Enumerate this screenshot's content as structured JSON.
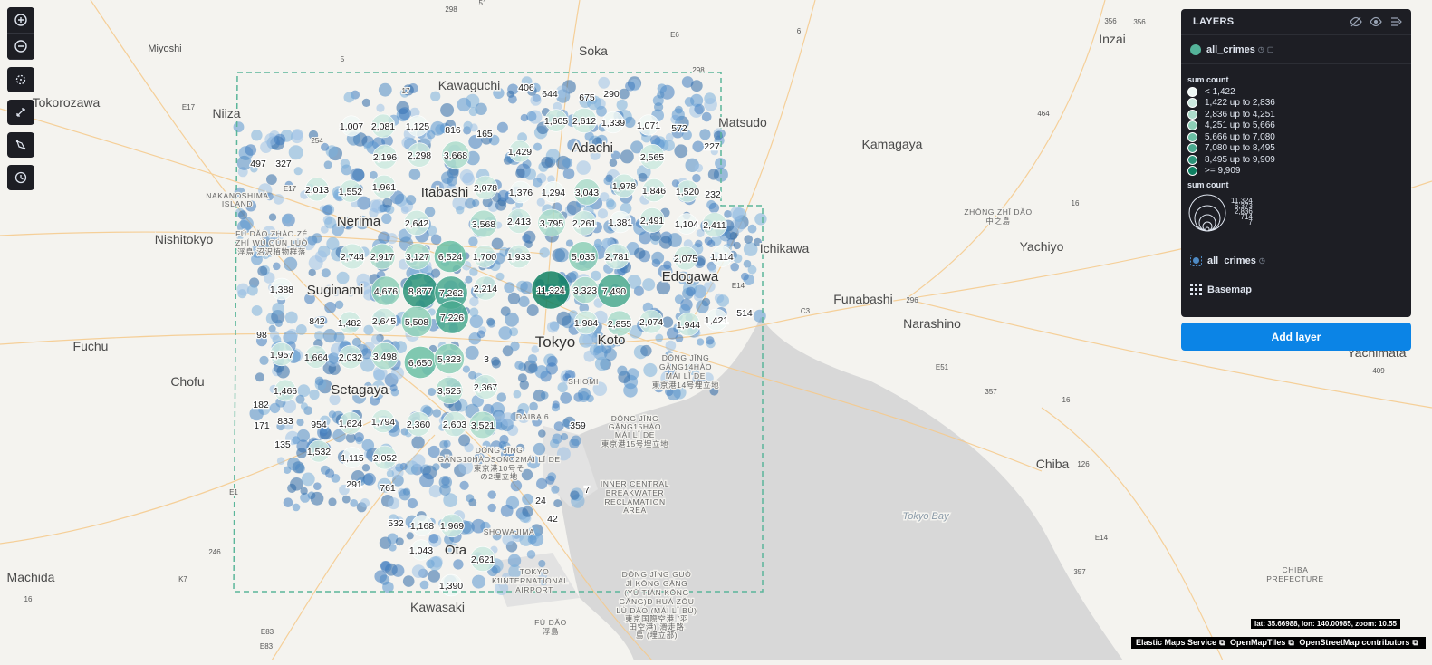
{
  "map": {
    "places": [
      {
        "name": "Soka",
        "kind": "city"
      },
      {
        "name": "Kawaguchi",
        "kind": "city"
      },
      {
        "name": "Miyoshi",
        "kind": "town"
      },
      {
        "name": "Tokorozawa",
        "kind": "city"
      },
      {
        "name": "Niiza",
        "kind": "city"
      },
      {
        "name": "Matsudo",
        "kind": "city"
      },
      {
        "name": "Inzai",
        "kind": "city"
      },
      {
        "name": "Kamagaya",
        "kind": "city"
      },
      {
        "name": "Adachi",
        "kind": "ward"
      },
      {
        "name": "Itabashi",
        "kind": "ward"
      },
      {
        "name": "Nerima",
        "kind": "ward"
      },
      {
        "name": "Nishitokyo",
        "kind": "city"
      },
      {
        "name": "Ichikawa",
        "kind": "city"
      },
      {
        "name": "Yachiyo",
        "kind": "city"
      },
      {
        "name": "Edogawa",
        "kind": "ward"
      },
      {
        "name": "Suginami",
        "kind": "ward"
      },
      {
        "name": "Funabashi",
        "kind": "city"
      },
      {
        "name": "Narashino",
        "kind": "city"
      },
      {
        "name": "Fuchu",
        "kind": "city"
      },
      {
        "name": "Tokyo",
        "kind": "big"
      },
      {
        "name": "Koto",
        "kind": "ward"
      },
      {
        "name": "Yachimata",
        "kind": "city"
      },
      {
        "name": "Chofu",
        "kind": "city"
      },
      {
        "name": "Setagaya",
        "kind": "ward"
      },
      {
        "name": "Chiba",
        "kind": "city"
      },
      {
        "name": "Machida",
        "kind": "city"
      },
      {
        "name": "Ota",
        "kind": "ward"
      },
      {
        "name": "Kawasaki",
        "kind": "city"
      },
      {
        "name": "Tokyo Bay",
        "kind": "water"
      }
    ],
    "small_labels": [
      {
        "text": "NAKANOSHIMA"
      },
      {
        "text": "ISLAND"
      },
      {
        "text": "FÚ DĂO ZHÀO ZÉ"
      },
      {
        "text": "ZHÍ WÙ QÚN LUÒ"
      },
      {
        "text": "浮島 沼沢植物群落"
      },
      {
        "text": "ZHŌNG ZHĪ DĂO"
      },
      {
        "text": "中之島"
      },
      {
        "text": "DŌNG JĪNG"
      },
      {
        "text": "GĂNG14HÀO"
      },
      {
        "text": "MÁI LĬ DE"
      },
      {
        "text": "東京港14号埋立地"
      },
      {
        "text": "SHIOMI"
      },
      {
        "text": "DAIBA 6"
      },
      {
        "text": "DŌNG JĪNG"
      },
      {
        "text": "GĂNG15HÀO"
      },
      {
        "text": "MÁI LĬ DE"
      },
      {
        "text": "東京港15号埋立地"
      },
      {
        "text": "DŌNG JĪNG"
      },
      {
        "text": "GĂNG10HÀOSONO2MÁI LĬ DE"
      },
      {
        "text": "東京港10号そ"
      },
      {
        "text": "の2埋立地"
      },
      {
        "text": "INNER CENTRAL"
      },
      {
        "text": "BREAKWATER"
      },
      {
        "text": "RECLAMATION"
      },
      {
        "text": "AREA"
      },
      {
        "text": "SHOWAJIMA"
      },
      {
        "text": "TOKYO"
      },
      {
        "text": "INTERNATIONAL"
      },
      {
        "text": "AIRPORT"
      },
      {
        "text": "DŌNG JĪNG GUÓ"
      },
      {
        "text": "JÌ KŌNG GĂNG"
      },
      {
        "text": "(YŬ TIÁN KŌNG"
      },
      {
        "text": "GĂNG)D HUÁ ZŎU"
      },
      {
        "text": "LÙ DĂO (MÁI LĬ BÙ)"
      },
      {
        "text": "東京国際空港 (羽"
      },
      {
        "text": "田空港) 滑走路"
      },
      {
        "text": "島 (埋立部)"
      },
      {
        "text": "FÚ DĂO"
      },
      {
        "text": "浮島"
      },
      {
        "text": "CHIBA"
      },
      {
        "text": "PREFECTURE"
      }
    ],
    "road_shields": [
      "298",
      "51",
      "5",
      "17",
      "E6",
      "298",
      "6",
      "356",
      "356",
      "E17",
      "254",
      "E17",
      "464",
      "16",
      "296",
      "C3",
      "E51",
      "357",
      "16",
      "409",
      "E83",
      "E1",
      "246",
      "K7",
      "16",
      "E83",
      "K1",
      "E14",
      "357",
      "126",
      "E14"
    ],
    "cluster_labels": [
      {
        "label": "1,007"
      },
      {
        "label": "2,081"
      },
      {
        "label": "1,125"
      },
      {
        "label": "816"
      },
      {
        "label": "165"
      },
      {
        "label": "406"
      },
      {
        "label": "644"
      },
      {
        "label": "675"
      },
      {
        "label": "290"
      },
      {
        "label": "1,605"
      },
      {
        "label": "2,612"
      },
      {
        "label": "1,339"
      },
      {
        "label": "1,071"
      },
      {
        "label": "572"
      },
      {
        "label": "2,196"
      },
      {
        "label": "2,298"
      },
      {
        "label": "3,668"
      },
      {
        "label": "1,429"
      },
      {
        "label": "2,565"
      },
      {
        "label": "227"
      },
      {
        "label": "497"
      },
      {
        "label": "327"
      },
      {
        "label": "2,013"
      },
      {
        "label": "1,552"
      },
      {
        "label": "1,961"
      },
      {
        "label": "2,078"
      },
      {
        "label": "1,376"
      },
      {
        "label": "1,294"
      },
      {
        "label": "3,043"
      },
      {
        "label": "1,978"
      },
      {
        "label": "1,846"
      },
      {
        "label": "1,520"
      },
      {
        "label": "232"
      },
      {
        "label": "2,642"
      },
      {
        "label": "3,568"
      },
      {
        "label": "2,413"
      },
      {
        "label": "3,795"
      },
      {
        "label": "2,261"
      },
      {
        "label": "1,381"
      },
      {
        "label": "2,491"
      },
      {
        "label": "1,104"
      },
      {
        "label": "2,411"
      },
      {
        "label": "2,744"
      },
      {
        "label": "2,917"
      },
      {
        "label": "3,127"
      },
      {
        "label": "6,524"
      },
      {
        "label": "1,700"
      },
      {
        "label": "1,933"
      },
      {
        "label": "5,035"
      },
      {
        "label": "2,781"
      },
      {
        "label": "2,075"
      },
      {
        "label": "1,114"
      },
      {
        "label": "1,388"
      },
      {
        "label": "4,676"
      },
      {
        "label": "8,877"
      },
      {
        "label": "7,262"
      },
      {
        "label": "2,214"
      },
      {
        "label": "11,324"
      },
      {
        "label": "3,323"
      },
      {
        "label": "7,490"
      },
      {
        "label": "842"
      },
      {
        "label": "1,482"
      },
      {
        "label": "2,645"
      },
      {
        "label": "5,508"
      },
      {
        "label": "7,226"
      },
      {
        "label": "1,984"
      },
      {
        "label": "2,855"
      },
      {
        "label": "2,074"
      },
      {
        "label": "1,944"
      },
      {
        "label": "1,421"
      },
      {
        "label": "514"
      },
      {
        "label": "98"
      },
      {
        "label": "1,957"
      },
      {
        "label": "1,664"
      },
      {
        "label": "2,032"
      },
      {
        "label": "3,498"
      },
      {
        "label": "6,650"
      },
      {
        "label": "5,323"
      },
      {
        "label": "3"
      },
      {
        "label": "1,466"
      },
      {
        "label": "3,525"
      },
      {
        "label": "2,367"
      },
      {
        "label": "182"
      },
      {
        "label": "171"
      },
      {
        "label": "833"
      },
      {
        "label": "954"
      },
      {
        "label": "1,624"
      },
      {
        "label": "1,794"
      },
      {
        "label": "2,360"
      },
      {
        "label": "2,603"
      },
      {
        "label": "3,521"
      },
      {
        "label": "359"
      },
      {
        "label": "135"
      },
      {
        "label": "1,532"
      },
      {
        "label": "1,115"
      },
      {
        "label": "2,052"
      },
      {
        "label": "291"
      },
      {
        "label": "761"
      },
      {
        "label": "7"
      },
      {
        "label": "24"
      },
      {
        "label": "42"
      },
      {
        "label": "532"
      },
      {
        "label": "1,168"
      },
      {
        "label": "1,969"
      },
      {
        "label": "1,043"
      },
      {
        "label": "2,621"
      },
      {
        "label": "1,390"
      }
    ]
  },
  "controls": {
    "zoom_in": "zoom-in",
    "zoom_out": "zoom-out"
  },
  "layers_panel": {
    "title": "LAYERS",
    "layers": [
      {
        "name": "all_crimes",
        "type": "clusters"
      },
      {
        "name": "all_crimes",
        "type": "documents"
      },
      {
        "name": "Basemap",
        "type": "basemap"
      }
    ],
    "legend": {
      "color_title": "sum count",
      "color_items": [
        {
          "label": "< 1,422",
          "color": "#eef7f4"
        },
        {
          "label": "1,422 up to 2,836",
          "color": "#cbe9df"
        },
        {
          "label": "2,836 up to 4,251",
          "color": "#acdccb"
        },
        {
          "label": "4,251 up to 5,666",
          "color": "#8dcfb7"
        },
        {
          "label": "5,666 up to 7,080",
          "color": "#6bbfa4"
        },
        {
          "label": "7,080 up to 8,495",
          "color": "#4aa98f"
        },
        {
          "label": "8,495 up to 9,909",
          "color": "#2d9479"
        },
        {
          "label": ">= 9,909",
          "color": "#108062"
        }
      ],
      "size_title": "sum count",
      "size_values": [
        "11,324",
        "6,373",
        "2,836",
        "714",
        "7"
      ]
    },
    "add_layer_label": "Add layer"
  },
  "status": {
    "coordinates": "lat: 35.66988, lon: 140.00985, zoom: 10.55"
  },
  "attribution": [
    "Elastic Maps Service",
    "OpenMapTiles",
    "OpenStreetMap contributors"
  ],
  "colors": {
    "accent": "#0b84e6",
    "cluster_blue": "#4e8ac4",
    "cluster_green_dark": "#108062",
    "cluster_green_light": "#a8d8c8",
    "panel_bg": "#1d1e24",
    "map_bg": "#f4f3ef",
    "water": "#d8d8d8",
    "bbox": "#5bb69a"
  }
}
